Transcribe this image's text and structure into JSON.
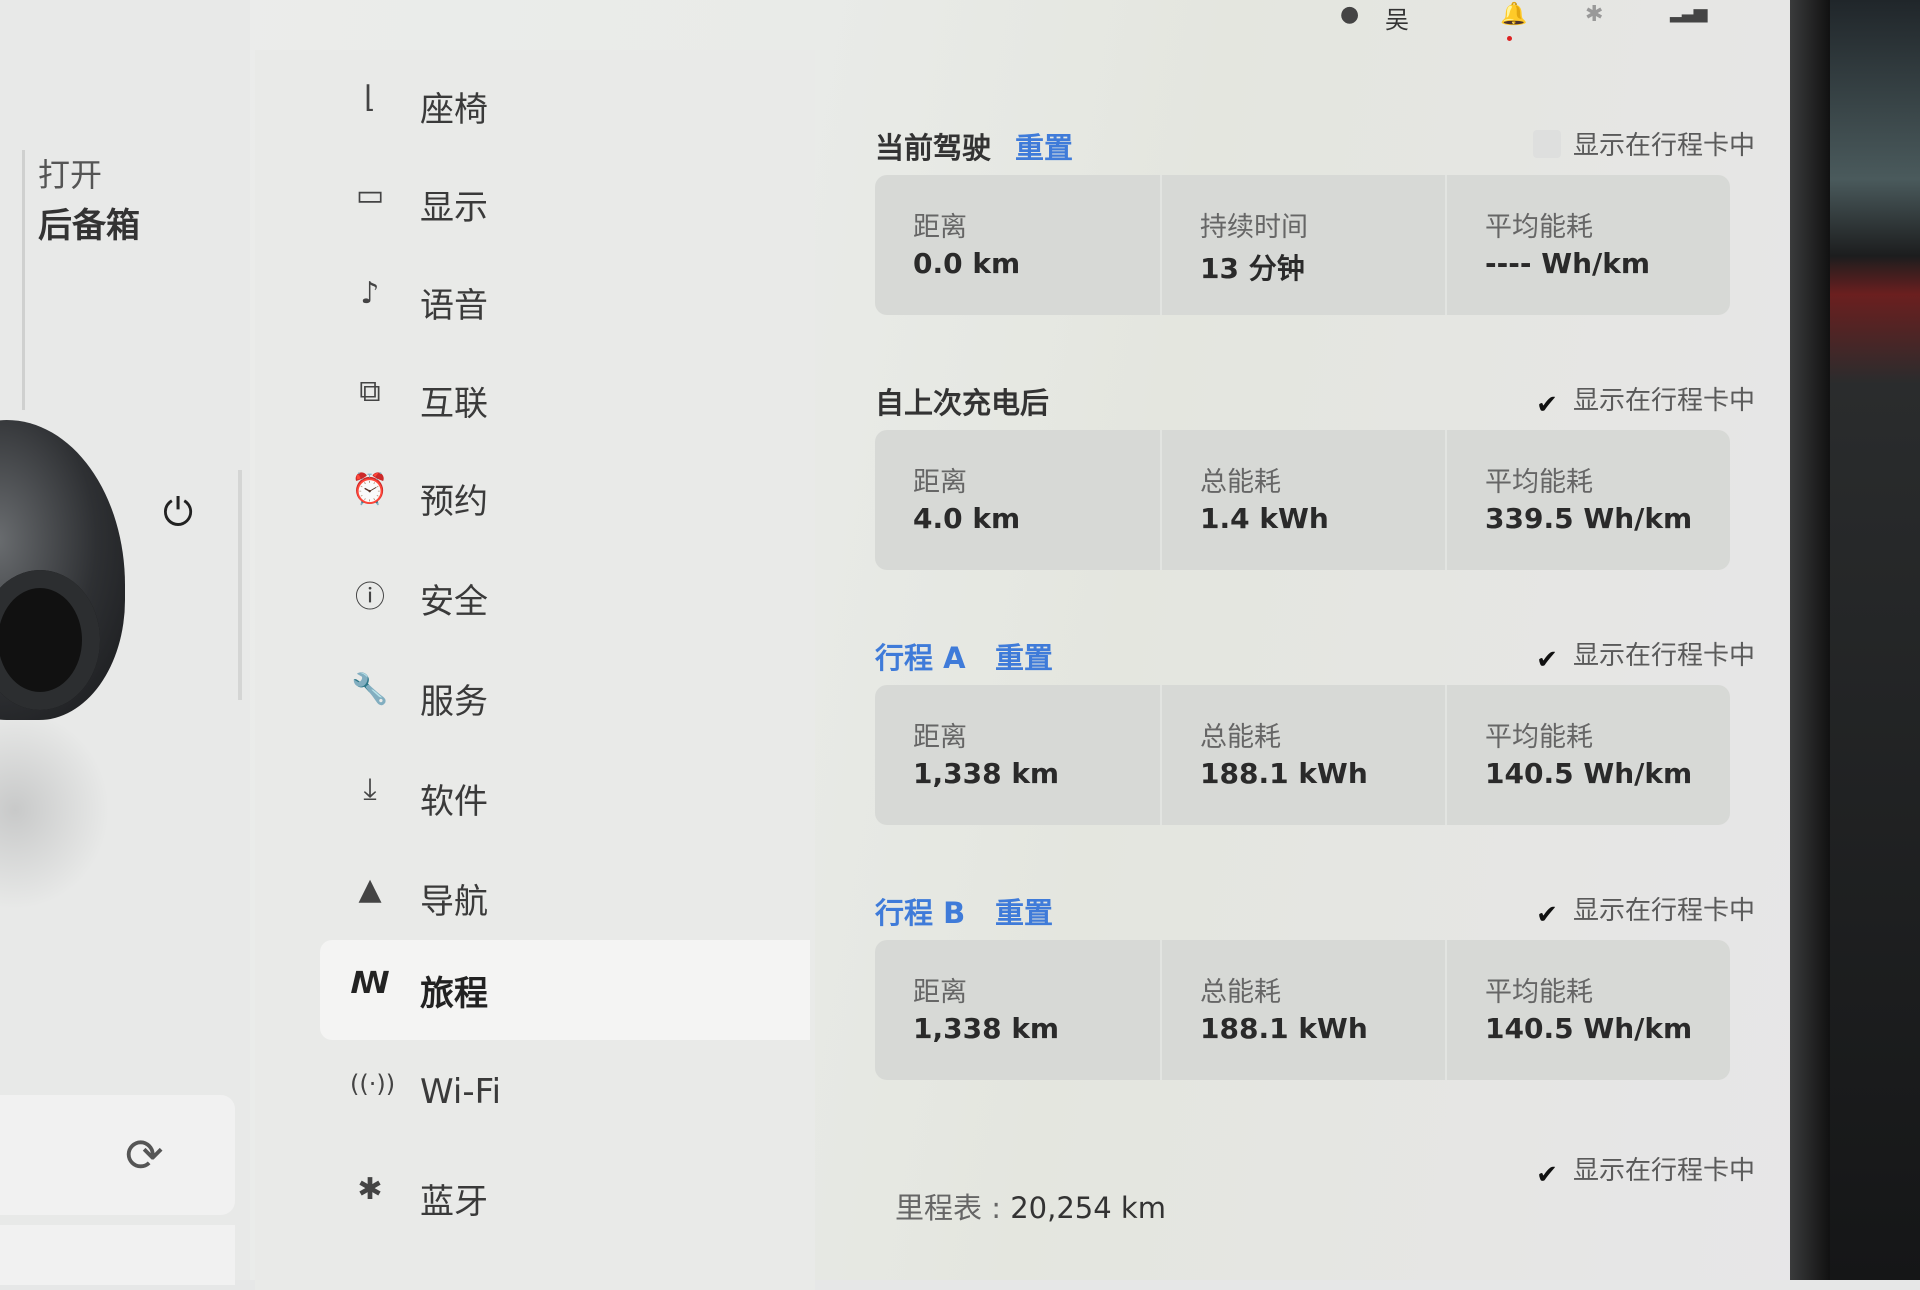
{
  "status_bar": {
    "profile_icon": "person-icon",
    "profile_name": "吴",
    "bell_icon": "bell-icon",
    "bluetooth_icon": "bluetooth-icon",
    "signal_icon": "signal-icon"
  },
  "car_panel": {
    "trunk_action": "打开",
    "trunk_label": "后备箱",
    "charge_icon": "charge-plug-icon",
    "sync_icon": "sync-icon"
  },
  "nav": {
    "items": [
      {
        "label": "座椅",
        "icon": "seat-icon",
        "glyph": "⌐"
      },
      {
        "label": "显示",
        "icon": "display-icon",
        "glyph": "▭"
      },
      {
        "label": "语音",
        "icon": "microphone-icon",
        "glyph": "🎙"
      },
      {
        "label": "互联",
        "icon": "connectivity-icon",
        "glyph": "⧉"
      },
      {
        "label": "预约",
        "icon": "schedule-clock-icon",
        "glyph": "⏰"
      },
      {
        "label": "安全",
        "icon": "safety-icon",
        "glyph": "ⓘ"
      },
      {
        "label": "服务",
        "icon": "wrench-icon",
        "glyph": "🔧"
      },
      {
        "label": "软件",
        "icon": "download-icon",
        "glyph": "⤓"
      },
      {
        "label": "导航",
        "icon": "navigation-arrow-icon",
        "glyph": "▲"
      },
      {
        "label": "旅程",
        "icon": "trips-icon",
        "glyph": "ᔕ"
      },
      {
        "label": "Wi-Fi",
        "icon": "wifi-icon",
        "glyph": "((·))"
      },
      {
        "label": "蓝牙",
        "icon": "bluetooth-icon",
        "glyph": "✱"
      }
    ],
    "active": "旅程"
  },
  "trips": {
    "current": {
      "title": "当前驾驶",
      "reset_label": "重置",
      "show_label": "显示在行程卡中",
      "show_checked": false,
      "stats": [
        {
          "label": "距离",
          "value": "0.0  km"
        },
        {
          "label": "持续时间",
          "value": "13  分钟"
        },
        {
          "label": "平均能耗",
          "value": "----  Wh/km"
        }
      ]
    },
    "since_charge": {
      "title": "自上次充电后",
      "show_label": "显示在行程卡中",
      "show_checked": true,
      "stats": [
        {
          "label": "距离",
          "value": "4.0  km"
        },
        {
          "label": "总能耗",
          "value": "1.4  kWh"
        },
        {
          "label": "平均能耗",
          "value": "339.5  Wh/km"
        }
      ]
    },
    "trip_a": {
      "title": "行程 A",
      "reset_label": "重置",
      "show_label": "显示在行程卡中",
      "show_checked": true,
      "stats": [
        {
          "label": "距离",
          "value": "1,338  km"
        },
        {
          "label": "总能耗",
          "value": "188.1  kWh"
        },
        {
          "label": "平均能耗",
          "value": "140.5  Wh/km"
        }
      ]
    },
    "trip_b": {
      "title": "行程 B",
      "reset_label": "重置",
      "show_label": "显示在行程卡中",
      "show_checked": true,
      "stats": [
        {
          "label": "距离",
          "value": "1,338  km"
        },
        {
          "label": "总能耗",
          "value": "188.1  kWh"
        },
        {
          "label": "平均能耗",
          "value": "140.5  Wh/km"
        }
      ]
    },
    "odometer": {
      "label": "里程表 :",
      "value": "20,254  km",
      "show_label": "显示在行程卡中",
      "show_checked": true
    }
  },
  "colors": {
    "accent": "#3f7bd9",
    "card_bg": "#d7d9d6",
    "screen_bg": "#e9eae8"
  }
}
